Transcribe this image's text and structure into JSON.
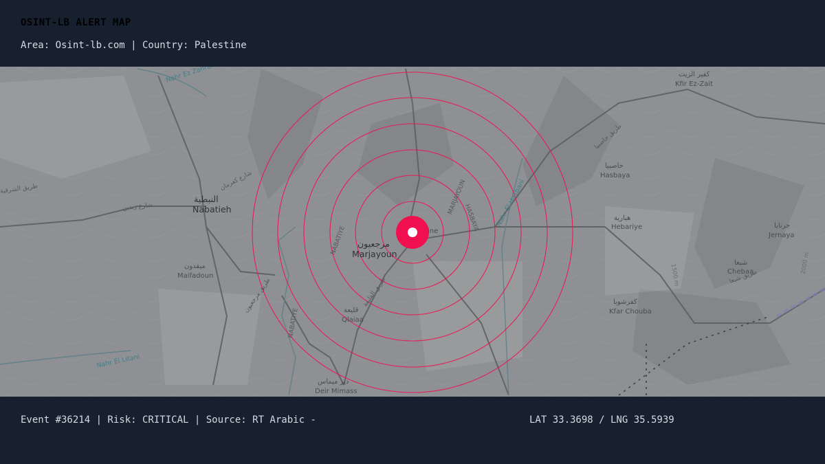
{
  "header": {
    "title": "OSINT-LB ALERT MAP",
    "subtitle": "Area: Osint-lb.com | Country: Palestine"
  },
  "footer": {
    "event": "Event #36214 | Risk: CRITICAL | Source: RT Arabic -",
    "coords": "LAT 33.3698 / LNG 35.5939"
  },
  "colors": {
    "alert": "#f0104f",
    "bar": "#101a28",
    "map_base": "#8f9093"
  },
  "marker_icon": "alert-target-icon",
  "places": {
    "marjayoun_ar": "مرجعيون",
    "marjayoun_en": "Marjayoun",
    "nabatieh_ar": "النبطية",
    "nabatieh_en": "Nabatieh",
    "maifadoun_ar": "ميفدون",
    "maifadoun_en": "Maifadoun",
    "qlaiaa_ar": "قليعة",
    "qlaiaa_en": "Qlaiaa",
    "hasbaya_ar": "حاصبيا",
    "hasbaya_en": "Hasbaya",
    "hebariye_ar": "هبارية",
    "hebariye_en": "Hebariye",
    "kfirezzait_ar": "كفير الزيت",
    "kfirezzait_en": "Kfir Ez-Zait",
    "jernaya_ar": "جرنايا",
    "jernaya_en": "Jernaya",
    "chebaa_ar": "شبعا",
    "chebaa_en": "Chebaa",
    "kfarchouba_ar": "كفرشوبا",
    "kfarchouba_en": "Kfar Chouba",
    "deirmimass_ar": "دير ميماس",
    "deirmimass_en": "Deir Mimass",
    "khiam_partial": "ine"
  },
  "map_labels": {
    "river_zahrani": "Nahr Ez Zahrani",
    "river_hasbani": "Nahr El Hasbani",
    "river_litani": "Nahr El Litani",
    "district_nabatiye": "NABATIYE",
    "district_marjayoun": "MARJAYOUN",
    "district_hasbaya": "HASBAYA",
    "district_nabatiye_2": "NABATIYE",
    "elev_1": "1500 m",
    "elev_2": "2000 m",
    "road_1": "طريق الشرقية",
    "road_2": "شارع زبدين",
    "road_3": "شارع كفرمان",
    "road_4": "طريق مرجعيون",
    "road_5": "طريق حاصبيا",
    "road_6": "طريق القليعة",
    "road_7": "طريق شبعا"
  }
}
